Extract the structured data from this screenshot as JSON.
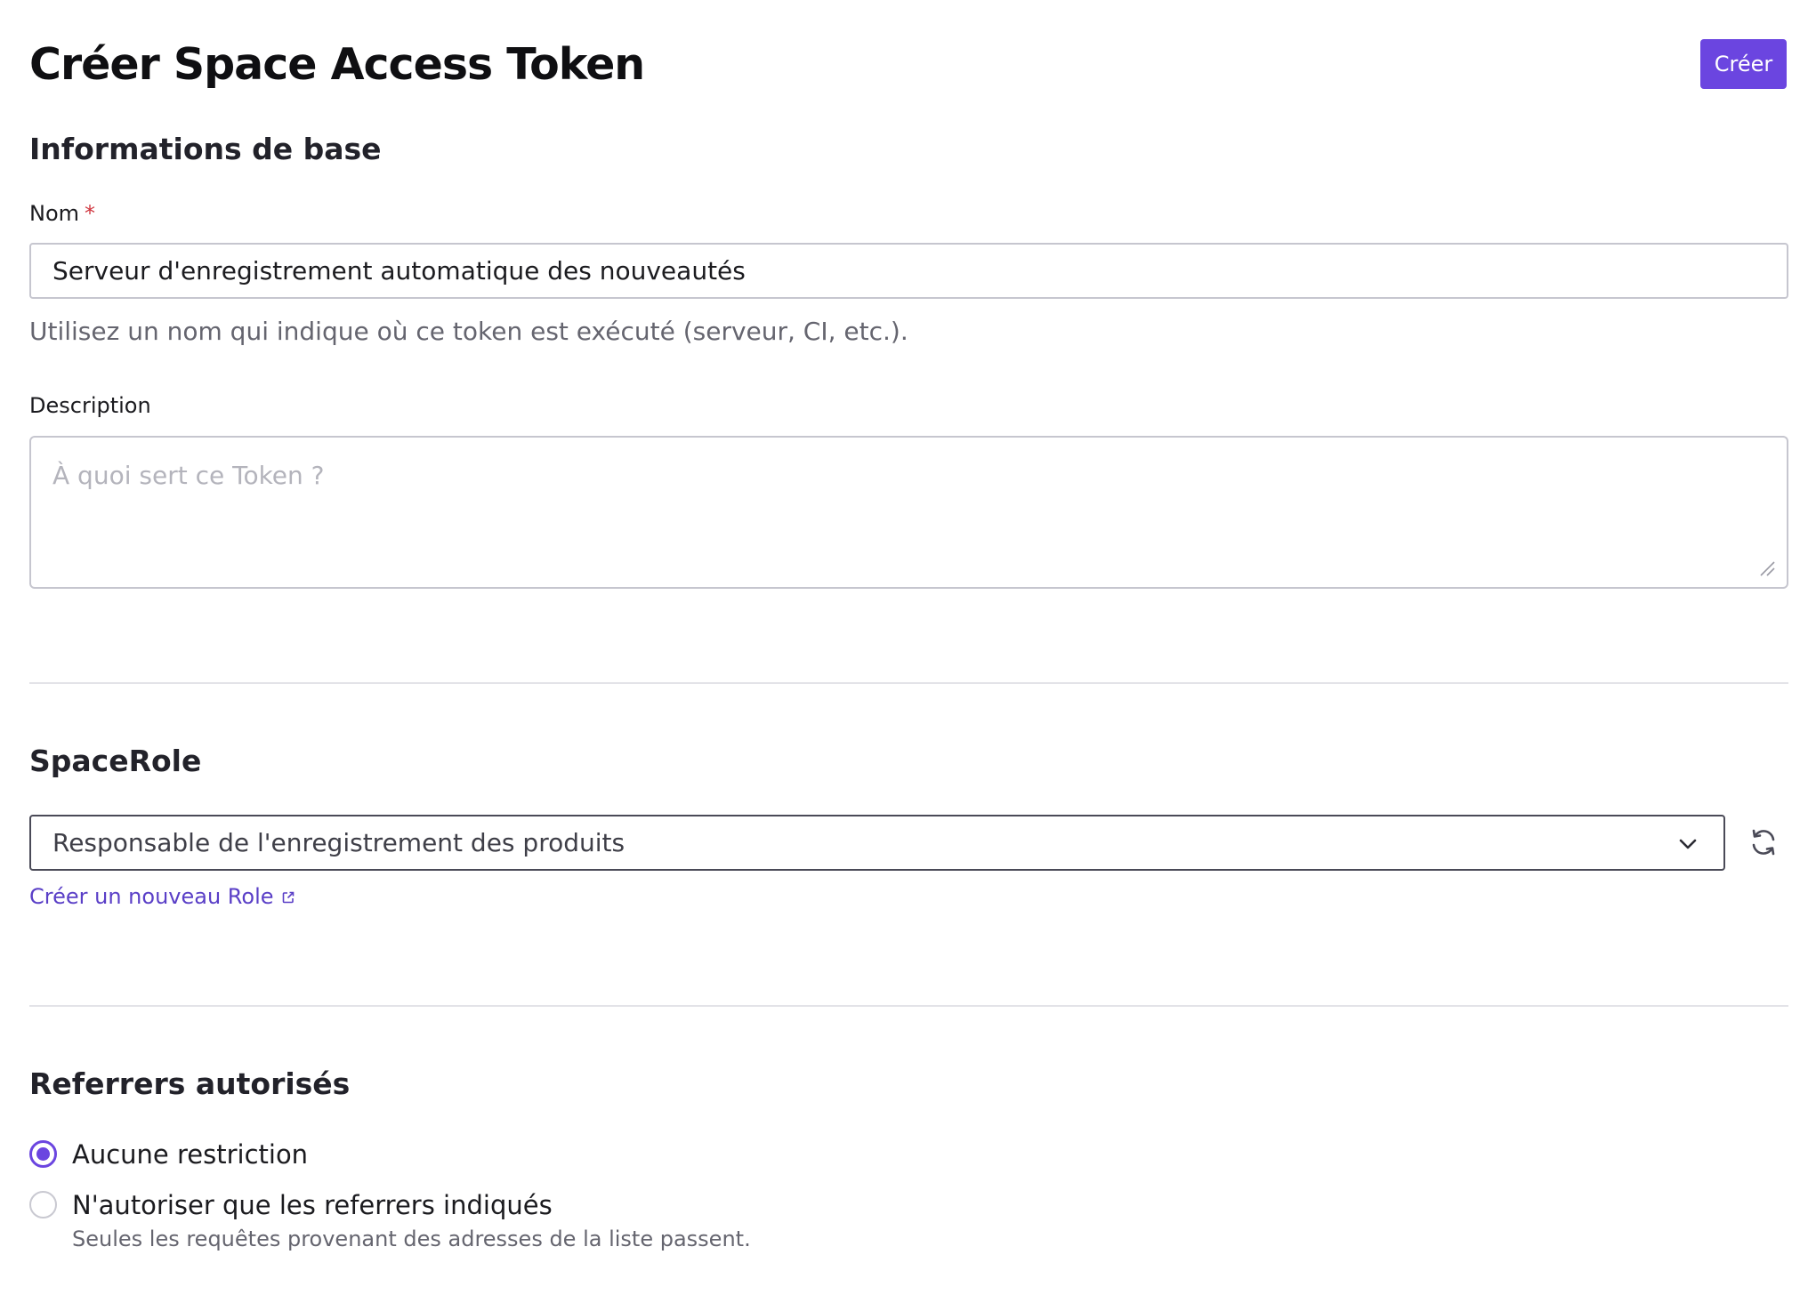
{
  "header": {
    "title": "Créer Space Access Token",
    "create_label": "Créer"
  },
  "basic_info": {
    "section_title": "Informations de base",
    "name_label": "Nom",
    "required_mark": "*",
    "name_value": "Serveur d'enregistrement automatique des nouveautés",
    "name_helper": "Utilisez un nom qui indique où ce token est exécuté (serveur, CI, etc.).",
    "description_label": "Description",
    "description_placeholder": "À quoi sert ce Token ?"
  },
  "space_role": {
    "section_title": "SpaceRole",
    "selected_value": "Responsable de l'enregistrement des produits",
    "create_role_link": "Créer un nouveau Role"
  },
  "referrers": {
    "section_title": "Referrers autorisés",
    "options": [
      {
        "label": "Aucune restriction",
        "checked": true
      },
      {
        "label": "N'autoriser que les referrers indiqués",
        "checked": false,
        "sublabel": "Seules les requêtes provenant des adresses de la liste passent."
      }
    ]
  },
  "colors": {
    "accent": "#6b45e0",
    "link": "#5a3fc7",
    "required": "#d0363f"
  },
  "icons": [
    "chevron-down-icon",
    "refresh-icon",
    "external-link-icon",
    "resize-handle-icon"
  ]
}
